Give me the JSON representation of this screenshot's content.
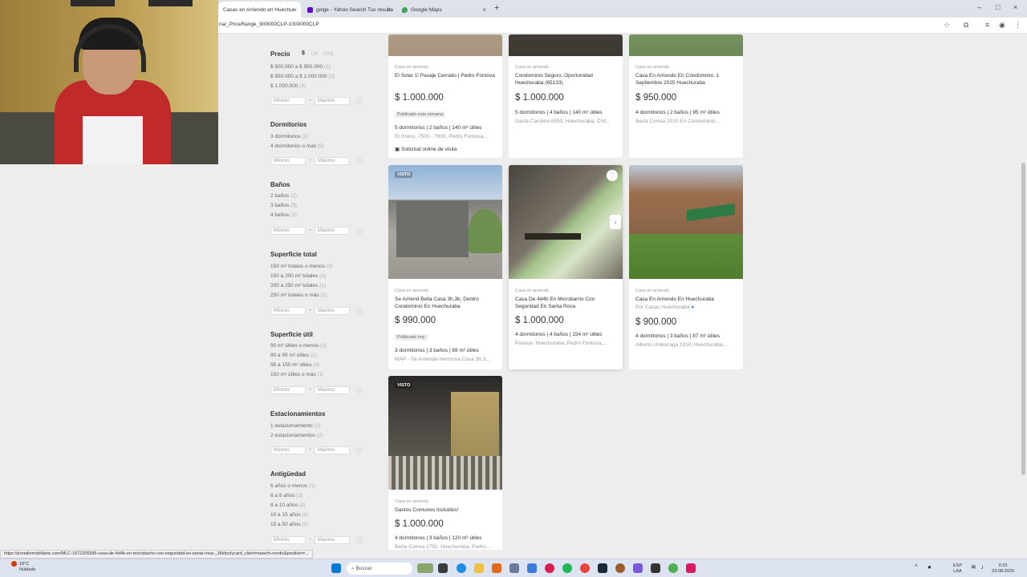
{
  "browser": {
    "tabs": [
      {
        "label": "Casas en Arriendo en Huechur",
        "active": true
      },
      {
        "label": "golge - Yahoo Search Tus resulta",
        "active": false
      },
      {
        "label": "Google Maps",
        "active": false
      }
    ],
    "url": "na/_PriceRange_900000CLP-1000000CLP"
  },
  "filters": {
    "precio": {
      "title": "Precio",
      "currencies": [
        "$",
        "UF",
        "US$"
      ],
      "options": [
        {
          "label": "$ 900.000 a $ 950.000",
          "count": "(1)"
        },
        {
          "label": "$ 950.000 a $ 1.000.000",
          "count": "(2)"
        },
        {
          "label": "$ 1.000.000",
          "count": "(4)"
        }
      ]
    },
    "dormitorios": {
      "title": "Dormitorios",
      "options": [
        {
          "label": "3 dormitorios",
          "count": "(2)"
        },
        {
          "label": "4 dormitorios o más",
          "count": "(5)"
        }
      ]
    },
    "banos": {
      "title": "Baños",
      "options": [
        {
          "label": "2 baños",
          "count": "(2)"
        },
        {
          "label": "3 baños",
          "count": "(3)"
        },
        {
          "label": "4 baños",
          "count": "(2)"
        }
      ]
    },
    "superficie_total": {
      "title": "Superficie total",
      "options": [
        {
          "label": "150 m² totales o menos",
          "count": "(2)"
        },
        {
          "label": "150 a 200 m² totales",
          "count": "(3)"
        },
        {
          "label": "200 a 250 m² totales",
          "count": "(1)"
        },
        {
          "label": "250 m² totales o más",
          "count": "(1)"
        }
      ]
    },
    "superficie_util": {
      "title": "Superficie útil",
      "options": [
        {
          "label": "90 m² útiles o menos",
          "count": "(2)"
        },
        {
          "label": "90 a 95 m² útiles",
          "count": "(1)"
        },
        {
          "label": "95 a 150 m² útiles",
          "count": "(4)"
        },
        {
          "label": "150 m² útiles o más",
          "count": "(1)"
        }
      ]
    },
    "estacionamientos": {
      "title": "Estacionamientos",
      "options": [
        {
          "label": "1 estacionamiento",
          "count": "(2)"
        },
        {
          "label": "2 estacionamientos",
          "count": "(2)"
        }
      ]
    },
    "antiguedad": {
      "title": "Antigüedad",
      "options": [
        {
          "label": "6 años o menos",
          "count": "(1)"
        },
        {
          "label": "6 a 8 años",
          "count": "(2)"
        },
        {
          "label": "8 a 10 años",
          "count": "(2)"
        },
        {
          "label": "10 a 15 años",
          "count": "(1)"
        },
        {
          "label": "15 a 50 años",
          "count": "(1)"
        }
      ]
    },
    "min_placeholder": "Mínimo",
    "max_placeholder": "Máximo",
    "dash": "–"
  },
  "listings": [
    {
      "kind": "Casa en arriendo",
      "title": "El Solar 1! Pasaje Cerrado | Pedro Fontova",
      "price": "$ 1.000.000",
      "badge": "Publicado esta semana",
      "attrs": "5 dormitorios | 2 baños | 140 m² útiles",
      "location": "El Greco, 7500 - 7900, Pedro Fontova,...",
      "visit": "Solicitud online de visita"
    },
    {
      "kind": "Casa en arriendo",
      "title": "Condominio Seguro, Oportunidad Huechuraba (65133)",
      "price": "$ 1.000.000",
      "attrs": "5 dormitorios | 4 baños | 140 m² útiles",
      "location": "Santa Carolina 6950, Huechuraba, Chil..."
    },
    {
      "kind": "Casa en arriendo",
      "title": "Casa En Arriendo En Condominio. 1 Septiembre 2025 Huechuraba",
      "price": "$ 950.000",
      "attrs": "4 dormitorios | 2 baños | 95 m² útiles",
      "location": "Berta Correa 2010 En Condominio..."
    },
    {
      "kind": "Casa en arriendo",
      "title": "Se Arriend Bella Casa 3h,3b, Dentro Condominio En Huechuraba",
      "price": "$ 990.000",
      "badge": "Publicado hoy",
      "attrs": "3 dormitorios | 3 baños | 89 m² útiles",
      "location": "MAP - Se Arrienda Hermosa Casa 3h,3...",
      "visto": "VISTO"
    },
    {
      "kind": "Casa en arriendo",
      "title": "Casa De 4d4b En Microbarrio Con Seguridad En Santa Rosa",
      "price": "$ 1.000.000",
      "attrs": "4 dormitorios | 4 baños | 154 m² útiles",
      "location": "Pasteur, Huechuraba, Pedro Fontova,..."
    },
    {
      "kind": "Casa en arriendo",
      "title": "Casa En Arriendo En Huechuraba",
      "seller": "Por Casas Huechuraba",
      "price": "$ 900.000",
      "attrs": "4 dormitorios | 3 baños | 87 m² útiles",
      "location": "Alberto Undurraga 1910, Huechuraba,..."
    },
    {
      "kind": "Casa en arriendo",
      "title": "Gastos Comunes Incluidos!",
      "price": "$ 1.000.000",
      "attrs": "4 dormitorios | 3 baños | 120 m² útiles",
      "location": "Berta Correa 1791, Huechuraba, Pedro...",
      "visto": "VISTO"
    }
  ],
  "status_url": "https://portalinmobiliario.com/MLC-1672206585-casa-de-4d4b-en-microbarrio-con-seguridad-en-santa-rosa-_JM#polycard_client=search-nordic&position=...",
  "taskbar": {
    "weather_temp": "18°C",
    "weather_desc": "Nublado",
    "search": "Buscar",
    "lang": "ESP",
    "lang2": "LAA",
    "time": "0:23",
    "date": "23-08-2025"
  },
  "colors": {
    "accent": "#3483fa",
    "card_bg": "#ffffff",
    "page_bg": "#ededed"
  }
}
